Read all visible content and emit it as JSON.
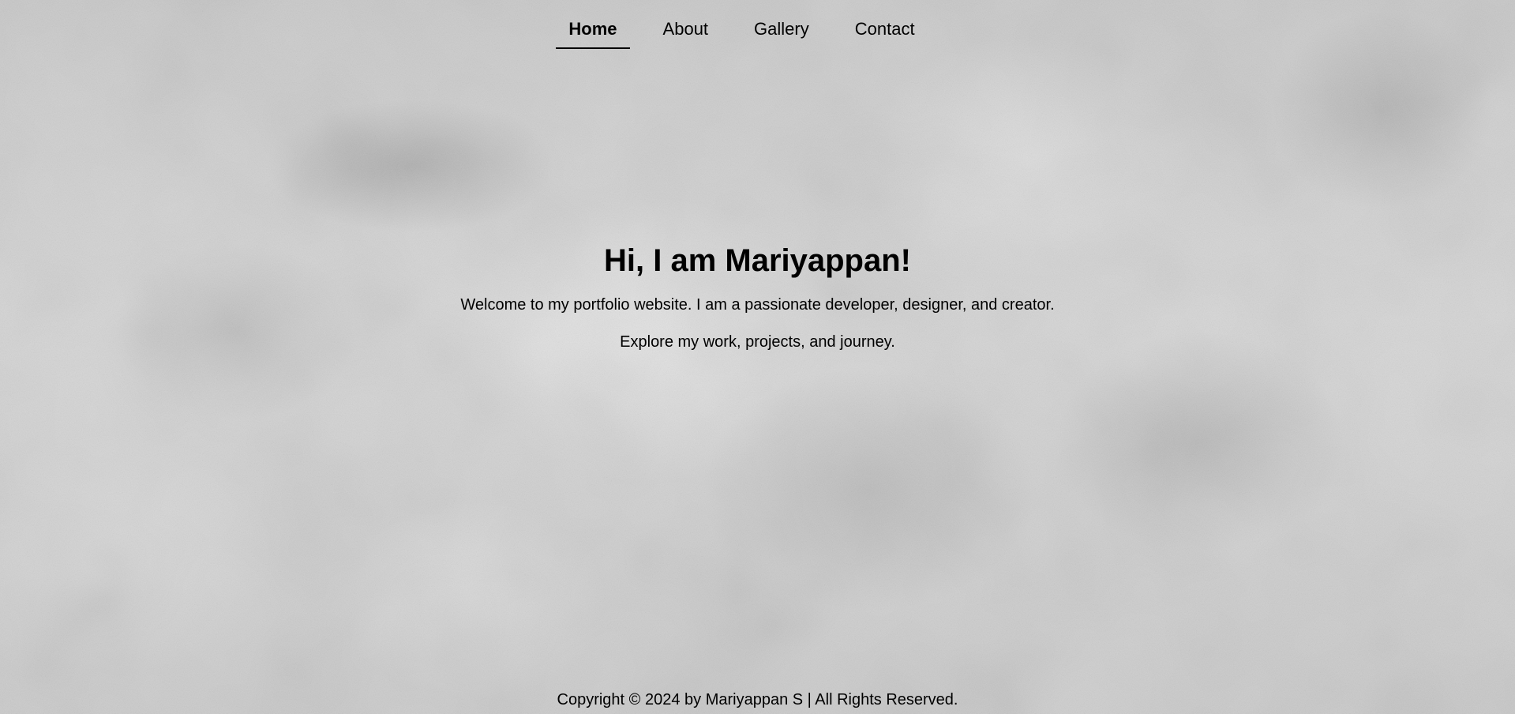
{
  "nav": {
    "items": [
      {
        "label": "Home",
        "active": true
      },
      {
        "label": "About",
        "active": false
      },
      {
        "label": "Gallery",
        "active": false
      },
      {
        "label": "Contact",
        "active": false
      }
    ]
  },
  "hero": {
    "title": "Hi, I am Mariyappan!",
    "intro": "Welcome to my portfolio website. I am a passionate developer, designer, and creator.",
    "subtext": "Explore my work, projects, and journey."
  },
  "footer": {
    "copyright": "Copyright © 2024 by Mariyappan S | All Rights Reserved."
  },
  "colors": {
    "text": "#000000",
    "background": "#cfcfcf"
  }
}
